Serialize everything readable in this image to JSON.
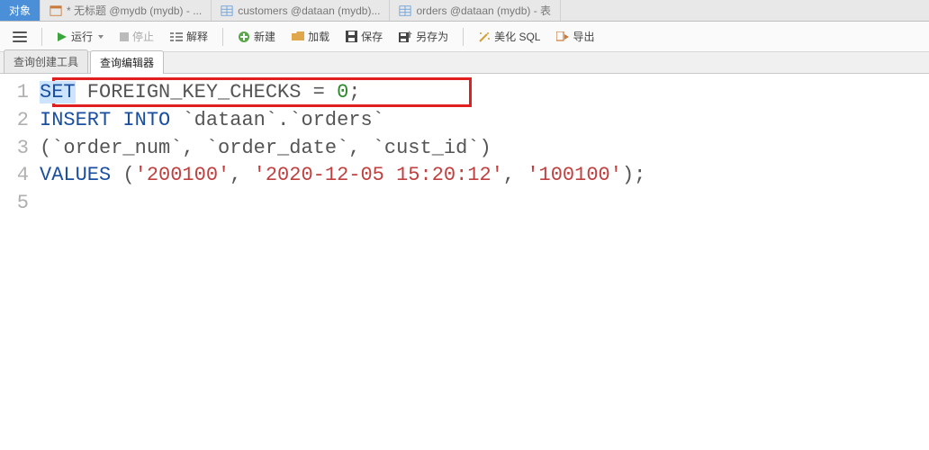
{
  "tabs": [
    {
      "label": "对象",
      "active": true
    },
    {
      "label": "* 无标题 @mydb (mydb) - ...",
      "active": false
    },
    {
      "label": "customers @dataan (mydb)...",
      "active": false
    },
    {
      "label": "orders @dataan (mydb) - 表",
      "active": false
    }
  ],
  "toolbar": {
    "run": "运行",
    "stop": "停止",
    "explain": "解释",
    "new": "新建",
    "load": "加载",
    "save": "保存",
    "saveAs": "另存为",
    "beautify": "美化 SQL",
    "export": "导出"
  },
  "subtabs": {
    "builder": "查询创建工具",
    "editor": "查询编辑器"
  },
  "code": {
    "l1_set": "SET",
    "l1_rest": " FOREIGN_KEY_CHECKS = ",
    "l1_num": "0",
    "l1_semi": ";",
    "l2_ins": "INSERT",
    "l2_into": "INTO",
    "l2_db": "`dataan`",
    "l2_dot": ".",
    "l2_tbl": "`orders`",
    "l3_open": "(",
    "l3_c1": "`order_num`",
    "l3_comma1": ", ",
    "l3_c2": "`order_date`",
    "l3_comma2": ", ",
    "l3_c3": "`cust_id`",
    "l3_close": ")",
    "l4_values": "VALUES",
    "l4_open": " (",
    "l4_v1": "'200100'",
    "l4_c1": ", ",
    "l4_v2": "'2020-12-05 15:20:12'",
    "l4_c2": ", ",
    "l4_v3": "'100100'",
    "l4_close": ");"
  },
  "gutter": [
    "1",
    "2",
    "3",
    "4",
    "5"
  ]
}
